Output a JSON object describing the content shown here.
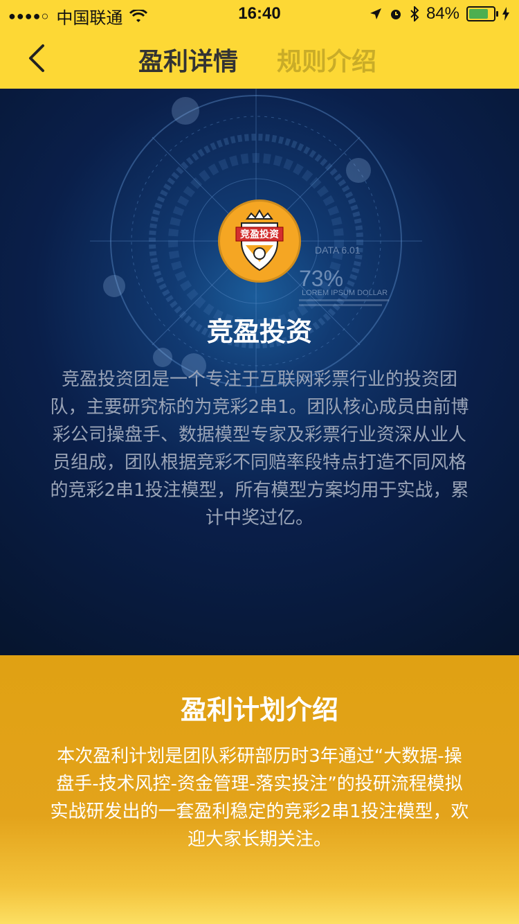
{
  "status_bar": {
    "carrier": "中国联通",
    "time": "16:40",
    "battery": "84%",
    "battery_fraction": 0.84
  },
  "nav": {
    "tab_active": "盈利详情",
    "tab_inactive": "规则介绍"
  },
  "hero": {
    "logo_text": "竞盈投资",
    "title": "竞盈投资",
    "description": "竞盈投资团是一个专注于互联网彩票行业的投资团队，主要研究标的为竞彩2串1。团队核心成员由前博彩公司操盘手、数据模型专家及彩票行业资深从业人员组成，团队根据竞彩不同赔率段特点打造不同风格的竞彩2串1投注模型，所有模型方案均用于实战，累计中奖过亿。",
    "decor_percent": "73%",
    "decor_caption": "LOREM IPSUM DOLLAR",
    "decor_data_label": "DATA 6.01"
  },
  "plan": {
    "title": "盈利计划介绍",
    "description": "本次盈利计划是团队彩研部历时3年通过“大数据-操盘手-技术风控-资金管理-落实投注”的投研流程模拟实战研发出的一套盈利稳定的竞彩2串1投注模型，欢迎大家长期关注。"
  }
}
